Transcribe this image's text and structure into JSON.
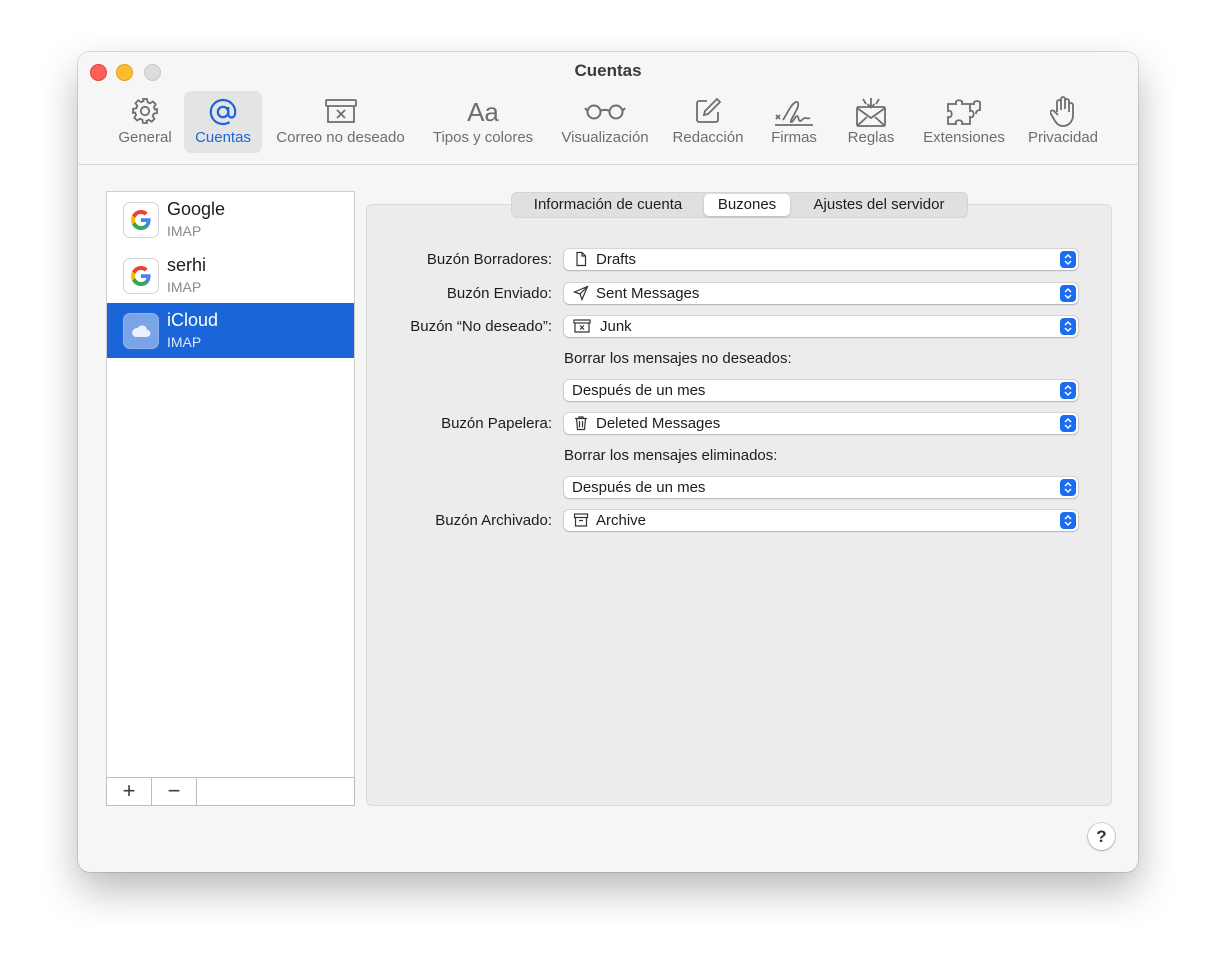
{
  "window": {
    "title": "Cuentas"
  },
  "toolbar": [
    {
      "id": "general",
      "label": "General",
      "icon": "gear-icon"
    },
    {
      "id": "accounts",
      "label": "Cuentas",
      "icon": "at-sign-icon",
      "active": true
    },
    {
      "id": "junk",
      "label": "Correo no deseado",
      "icon": "junk-tray-icon"
    },
    {
      "id": "fonts",
      "label": "Tipos y colores",
      "icon": "font-aa-icon",
      "glyph": "Aa"
    },
    {
      "id": "viewing",
      "label": "Visualización",
      "icon": "glasses-icon"
    },
    {
      "id": "composing",
      "label": "Redacción",
      "icon": "compose-icon"
    },
    {
      "id": "signatures",
      "label": "Firmas",
      "icon": "signature-icon"
    },
    {
      "id": "rules",
      "label": "Reglas",
      "icon": "envelope-rules-icon"
    },
    {
      "id": "extensions",
      "label": "Extensiones",
      "icon": "puzzle-icon"
    },
    {
      "id": "privacy",
      "label": "Privacidad",
      "icon": "hand-icon"
    }
  ],
  "accounts": [
    {
      "name": "Google",
      "type": "IMAP",
      "icon": "google-logo-icon"
    },
    {
      "name": "serhi",
      "type": "IMAP",
      "icon": "google-logo-icon"
    },
    {
      "name": "iCloud",
      "type": "IMAP",
      "icon": "icloud-icon",
      "selected": true
    }
  ],
  "list_buttons": {
    "add": "+",
    "remove": "−"
  },
  "tabs": [
    {
      "label": "Información de cuenta"
    },
    {
      "label": "Buzones",
      "active": true
    },
    {
      "label": "Ajustes del servidor"
    }
  ],
  "mailboxes": {
    "drafts": {
      "label": "Buzón Borradores:",
      "value": "Drafts",
      "icon": "document-icon"
    },
    "sent": {
      "label": "Buzón Enviado:",
      "value": "Sent Messages",
      "icon": "paper-plane-icon"
    },
    "junk": {
      "label": "Buzón “No deseado”:",
      "value": "Junk",
      "icon": "junk-tray-icon"
    },
    "junk_erase": {
      "label": "Borrar los mensajes no deseados:",
      "value": "Después de un mes"
    },
    "trash": {
      "label": "Buzón Papelera:",
      "value": "Deleted Messages",
      "icon": "trash-icon"
    },
    "trash_erase": {
      "label": "Borrar los mensajes eliminados:",
      "value": "Después de un mes"
    },
    "archive": {
      "label": "Buzón Archivado:",
      "value": "Archive",
      "icon": "archive-box-icon"
    }
  },
  "help": {
    "label": "?"
  },
  "colors": {
    "accent": "#1a66d8",
    "stepper": "#1a6cf0",
    "close": "#fe5f57",
    "minimize": "#febc2e"
  }
}
